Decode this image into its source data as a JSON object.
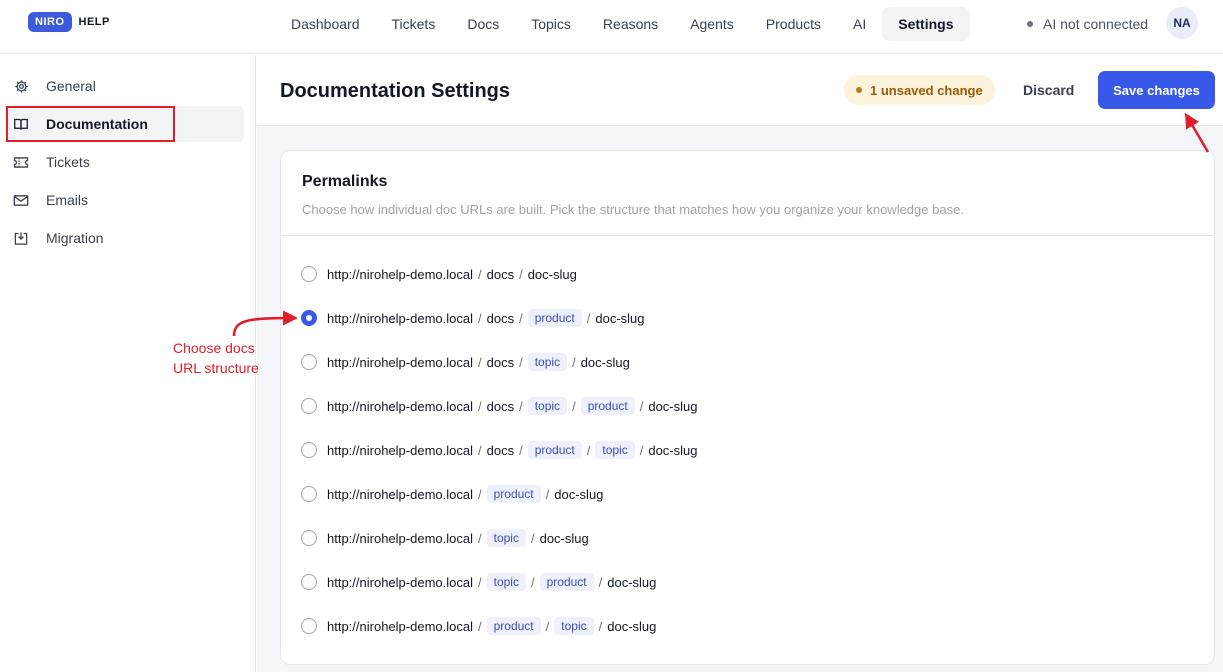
{
  "brand": {
    "badge": "NIRO",
    "name": "HELP",
    "accent": "#3b5bdb"
  },
  "nav": {
    "items": [
      {
        "label": "Dashboard"
      },
      {
        "label": "Tickets"
      },
      {
        "label": "Docs"
      },
      {
        "label": "Topics"
      },
      {
        "label": "Reasons"
      },
      {
        "label": "Agents"
      },
      {
        "label": "Products"
      },
      {
        "label": "AI"
      },
      {
        "label": "Settings",
        "active": true
      }
    ],
    "ai_status": "AI not connected",
    "avatar_initials": "NA"
  },
  "sidebar": {
    "items": [
      {
        "label": "General",
        "icon": "gear-icon"
      },
      {
        "label": "Documentation",
        "icon": "book-icon",
        "active": true
      },
      {
        "label": "Tickets",
        "icon": "ticket-icon"
      },
      {
        "label": "Emails",
        "icon": "mail-icon"
      },
      {
        "label": "Migration",
        "icon": "import-icon"
      }
    ]
  },
  "header": {
    "title": "Documentation Settings",
    "unsaved_badge": "1 unsaved change",
    "discard_label": "Discard",
    "save_label": "Save changes"
  },
  "permalinks": {
    "title": "Permalinks",
    "description": "Choose how individual doc URLs are built. Pick the structure that matches how you organize your knowledge base.",
    "base_url": "http://nirohelp-demo.local",
    "options": [
      {
        "checked": false,
        "parts": [
          "docs",
          "doc-slug"
        ],
        "tokens": [
          false,
          false
        ]
      },
      {
        "checked": true,
        "parts": [
          "docs",
          "product",
          "doc-slug"
        ],
        "tokens": [
          false,
          true,
          false
        ]
      },
      {
        "checked": false,
        "parts": [
          "docs",
          "topic",
          "doc-slug"
        ],
        "tokens": [
          false,
          true,
          false
        ]
      },
      {
        "checked": false,
        "parts": [
          "docs",
          "topic",
          "product",
          "doc-slug"
        ],
        "tokens": [
          false,
          true,
          true,
          false
        ]
      },
      {
        "checked": false,
        "parts": [
          "docs",
          "product",
          "topic",
          "doc-slug"
        ],
        "tokens": [
          false,
          true,
          true,
          false
        ]
      },
      {
        "checked": false,
        "parts": [
          "product",
          "doc-slug"
        ],
        "tokens": [
          true,
          false
        ]
      },
      {
        "checked": false,
        "parts": [
          "topic",
          "doc-slug"
        ],
        "tokens": [
          true,
          false
        ]
      },
      {
        "checked": false,
        "parts": [
          "topic",
          "product",
          "doc-slug"
        ],
        "tokens": [
          true,
          true,
          false
        ]
      },
      {
        "checked": false,
        "parts": [
          "product",
          "topic",
          "doc-slug"
        ],
        "tokens": [
          true,
          true,
          false
        ]
      }
    ]
  },
  "annotation": {
    "line1": "Choose docs",
    "line2": "URL structure",
    "color": "#e11d2a"
  }
}
